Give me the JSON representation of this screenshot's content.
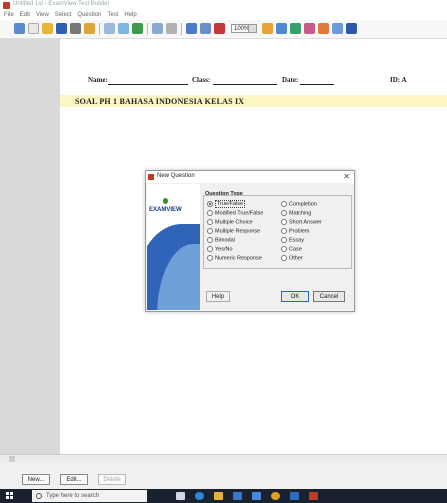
{
  "window": {
    "title": "Untitled 1st - ExamView Test Builder"
  },
  "menu": [
    "File",
    "Edit",
    "View",
    "Select",
    "Question",
    "Test",
    "Help"
  ],
  "toolbar": {
    "zoom": "100%"
  },
  "header": {
    "name_label": "Name:",
    "class_label": "Class:",
    "date_label": "Date:",
    "id_label": "ID: A"
  },
  "document": {
    "title": "SOAL PH 1 BAHASA INDONESIA KELAS IX"
  },
  "dialog": {
    "title": "New Question",
    "logo_text": "EXAMVIEW",
    "group_title": "Question Type",
    "options_left": [
      "True/False",
      "Modified True/False",
      "Multiple Choice",
      "Multiple Response",
      "Bimodal",
      "Yes/No",
      "Numeric Response"
    ],
    "options_right": [
      "Completion",
      "Matching",
      "Short Answer",
      "Problem",
      "Essay",
      "Case",
      "Other"
    ],
    "selected": "True/False",
    "help": "Help",
    "ok": "OK",
    "cancel": "Cancel"
  },
  "bottom_buttons": {
    "new": "New...",
    "edit": "Edit...",
    "delete": "Delete"
  },
  "taskbar": {
    "search_placeholder": "Type here to search"
  }
}
